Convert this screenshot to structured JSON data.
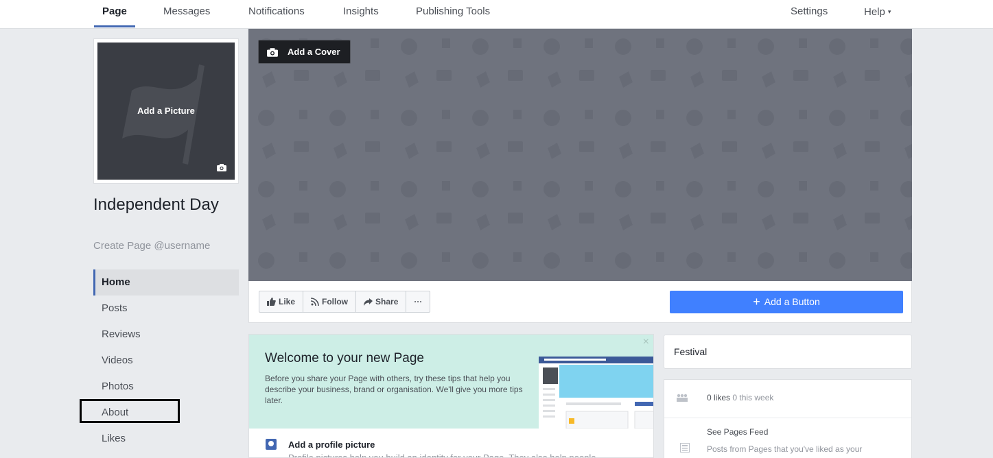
{
  "topnav": {
    "tabs": [
      {
        "label": "Page",
        "active": true
      },
      {
        "label": "Messages"
      },
      {
        "label": "Notifications"
      },
      {
        "label": "Insights"
      },
      {
        "label": "Publishing Tools"
      }
    ],
    "settings_label": "Settings",
    "help_label": "Help",
    "help_caret": "▾"
  },
  "profile": {
    "add_picture_label": "Add a Picture",
    "page_name": "Independent Day",
    "username_prompt": "Create Page @username"
  },
  "leftnav": {
    "items": [
      {
        "label": "Home",
        "active": true
      },
      {
        "label": "Posts"
      },
      {
        "label": "Reviews"
      },
      {
        "label": "Videos"
      },
      {
        "label": "Photos"
      },
      {
        "label": "About",
        "highlighted": true
      },
      {
        "label": "Likes"
      }
    ]
  },
  "cover": {
    "add_cover_label": "Add a Cover"
  },
  "actions": {
    "like_label": "Like",
    "follow_label": "Follow",
    "share_label": "Share",
    "more_label": "···",
    "add_button_label": "Add a Button",
    "add_button_plus": "+"
  },
  "welcome": {
    "title": "Welcome to your new Page",
    "body": "Before you share your Page with others, try these tips that help you describe your business, brand or organisation. We'll give you more tips later.",
    "close_label": "×",
    "tip_title": "Add a profile picture",
    "tip_body": "Profile pictures help you build an identity for your Page. They also help people"
  },
  "right": {
    "category": "Festival",
    "likes_count": "0 likes",
    "likes_week": "0 this week",
    "feed_title": "See Pages Feed",
    "feed_desc": "Posts from Pages that you've liked as your"
  },
  "colors": {
    "brand_blue": "#4267b2",
    "button_blue": "#4080ff",
    "cover_gray": "#6f737e",
    "welcome_mint": "#cdeee6",
    "page_bg": "#e9ebee"
  }
}
